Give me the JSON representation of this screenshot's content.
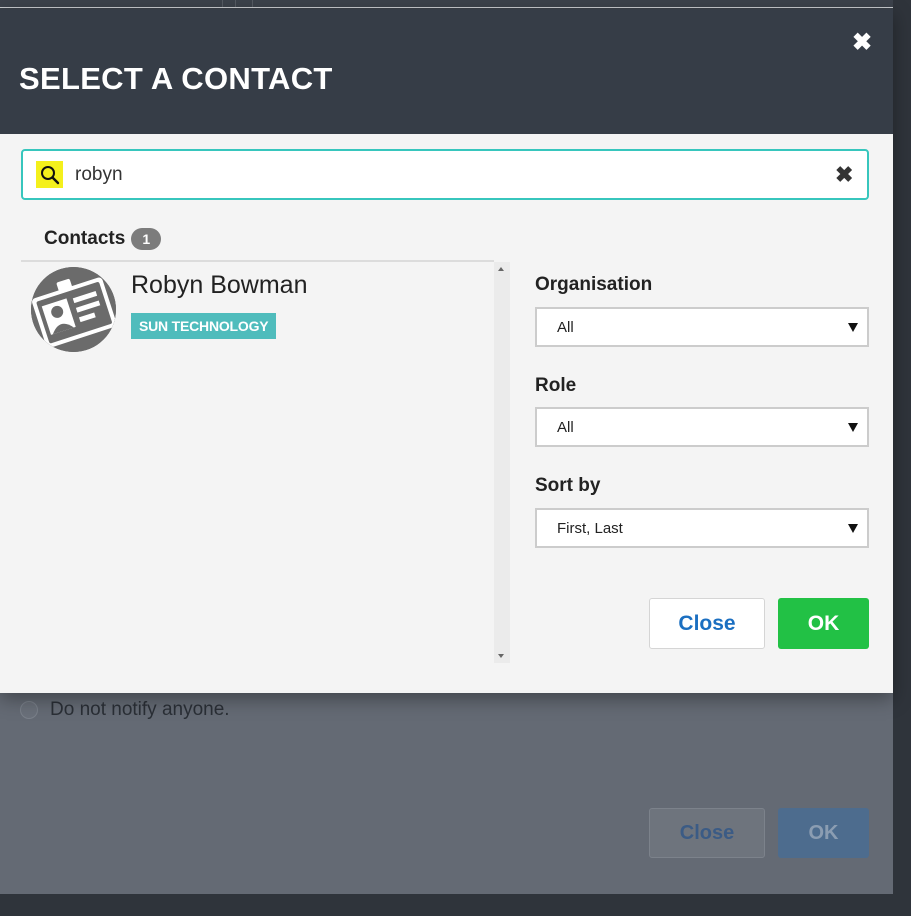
{
  "background": {
    "radio_label": "Do not notify anyone.",
    "close_label": "Close",
    "ok_label": "OK"
  },
  "dialog": {
    "title": "SELECT A CONTACT",
    "close_icon": "close-icon"
  },
  "search": {
    "value": "robyn",
    "icon": "search-icon",
    "clear_icon": "clear-icon"
  },
  "contacts": {
    "heading": "Contacts",
    "count": "1",
    "items": [
      {
        "name": "Robyn Bowman",
        "organisation": "SUN TECHNOLOGY",
        "avatar_icon": "id-card-avatar-icon"
      }
    ]
  },
  "filters": {
    "organisation": {
      "label": "Organisation",
      "value": "All"
    },
    "role": {
      "label": "Role",
      "value": "All"
    },
    "sort_by": {
      "label": "Sort by",
      "value": "First, Last"
    }
  },
  "buttons": {
    "close": "Close",
    "ok": "OK"
  },
  "colors": {
    "header_bg": "#363d47",
    "search_border": "#37c6bd",
    "search_icon_bg": "#f4f01c",
    "org_tag": "#4fbcbc",
    "ok_button": "#22c145",
    "close_button_text": "#1b6fc1"
  }
}
